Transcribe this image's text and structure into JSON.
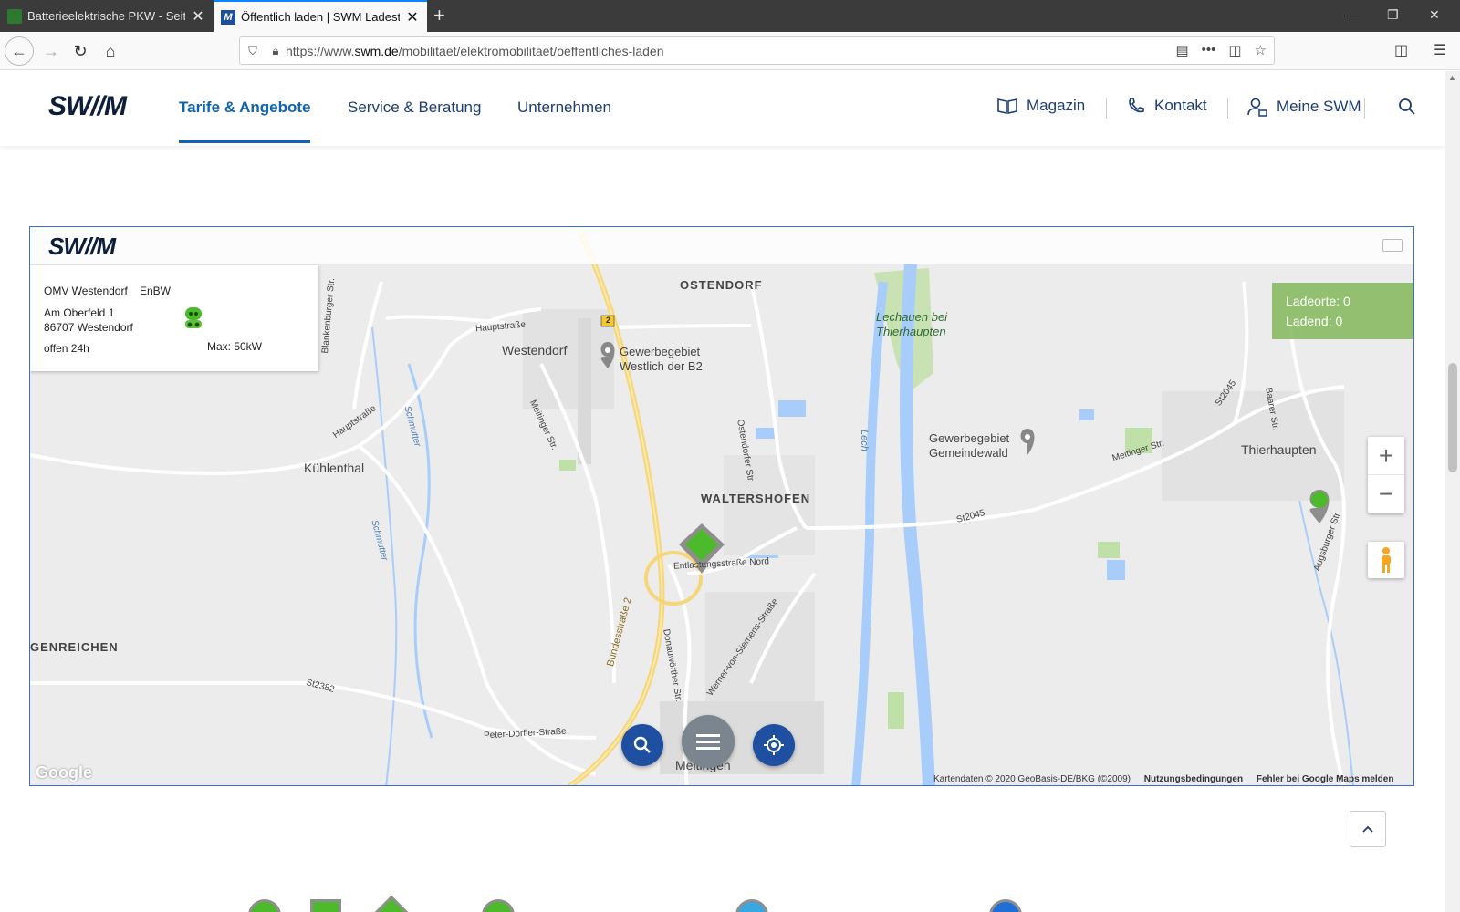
{
  "browser": {
    "tabs": [
      {
        "title": "Batterieelektrische PKW - Seite",
        "active": false
      },
      {
        "title": "Öffentlich laden | SWM Ladesta",
        "active": true
      }
    ],
    "url_prefix": "https://www.",
    "url_domain": "swm.de",
    "url_path": "/mobilitaet/elektromobilitaet/oeffentliches-laden"
  },
  "header": {
    "logo": "SW//M",
    "nav": [
      {
        "label": "Tarife & Angebote",
        "active": true
      },
      {
        "label": "Service & Beratung",
        "active": false
      },
      {
        "label": "Unternehmen",
        "active": false
      }
    ],
    "utility": [
      {
        "label": "Magazin",
        "icon": "book-icon"
      },
      {
        "label": "Kontakt",
        "icon": "phone-icon"
      },
      {
        "label": "Meine SWM",
        "icon": "user-lock-icon"
      }
    ]
  },
  "map": {
    "logo": "SW//M",
    "info": {
      "name": "OMV Westendorf",
      "operator": "EnBW",
      "street": "Am Oberfeld 1",
      "city": "86707 Westendorf",
      "hours": "offen 24h",
      "power": "Max: 50kW"
    },
    "counts": {
      "ladeorte": "Ladeorte: 0",
      "ladend": "Ladend: 0"
    },
    "places": {
      "ostendorf": "OSTENDORF",
      "westendorf": "Westendorf",
      "gewerbe_b2_1": "Gewerbegebiet",
      "gewerbe_b2_2": "Westlich der B2",
      "lechauen_1": "Lechauen bei",
      "lechauen_2": "Thierhaupten",
      "kuehlenthal": "Kühlenthal",
      "waltershofen": "WALTERSHOFEN",
      "gewerbe_gw_1": "Gewerbegebiet",
      "gewerbe_gw_2": "Gemeindewald",
      "thierhaupten": "Thierhaupten",
      "genreichen": "GENREICHEN",
      "meitingen": "Meitingen"
    },
    "roads": {
      "hauptstrasse": "Hauptstraße",
      "blankenburger": "Blankenburger Str.",
      "schmutter": "Schmutter",
      "meitinger": "Meitinger Str.",
      "ostendorfer": "Ostendorfer Str.",
      "lech": "Lech",
      "st2045_a": "St2045",
      "st2045_b": "St2045",
      "baarer": "Baarer Str.",
      "entlastung": "Entlastungsstraße Nord",
      "bundesstrasse": "Bundesstraße 2",
      "donauwoerther": "Donauwörther Str.",
      "wernervonsiemens": "Werner-von-Siemens-Straße",
      "st2382": "St2382",
      "peterdoerfler": "Peter-Dörfler-Straße",
      "augsburger": "Augsburger Str.",
      "b2shield": "2"
    },
    "attribution": "Kartendaten © 2020 GeoBasis-DE/BKG (©2009)",
    "terms": "Nutzungsbedingungen",
    "report": "Fehler bei Google Maps melden",
    "google": "Google"
  },
  "colors": {
    "accent": "#0f63b0",
    "nav": "#1d3e73",
    "green": "#5fb84a",
    "fab": "#1f4fa0"
  }
}
